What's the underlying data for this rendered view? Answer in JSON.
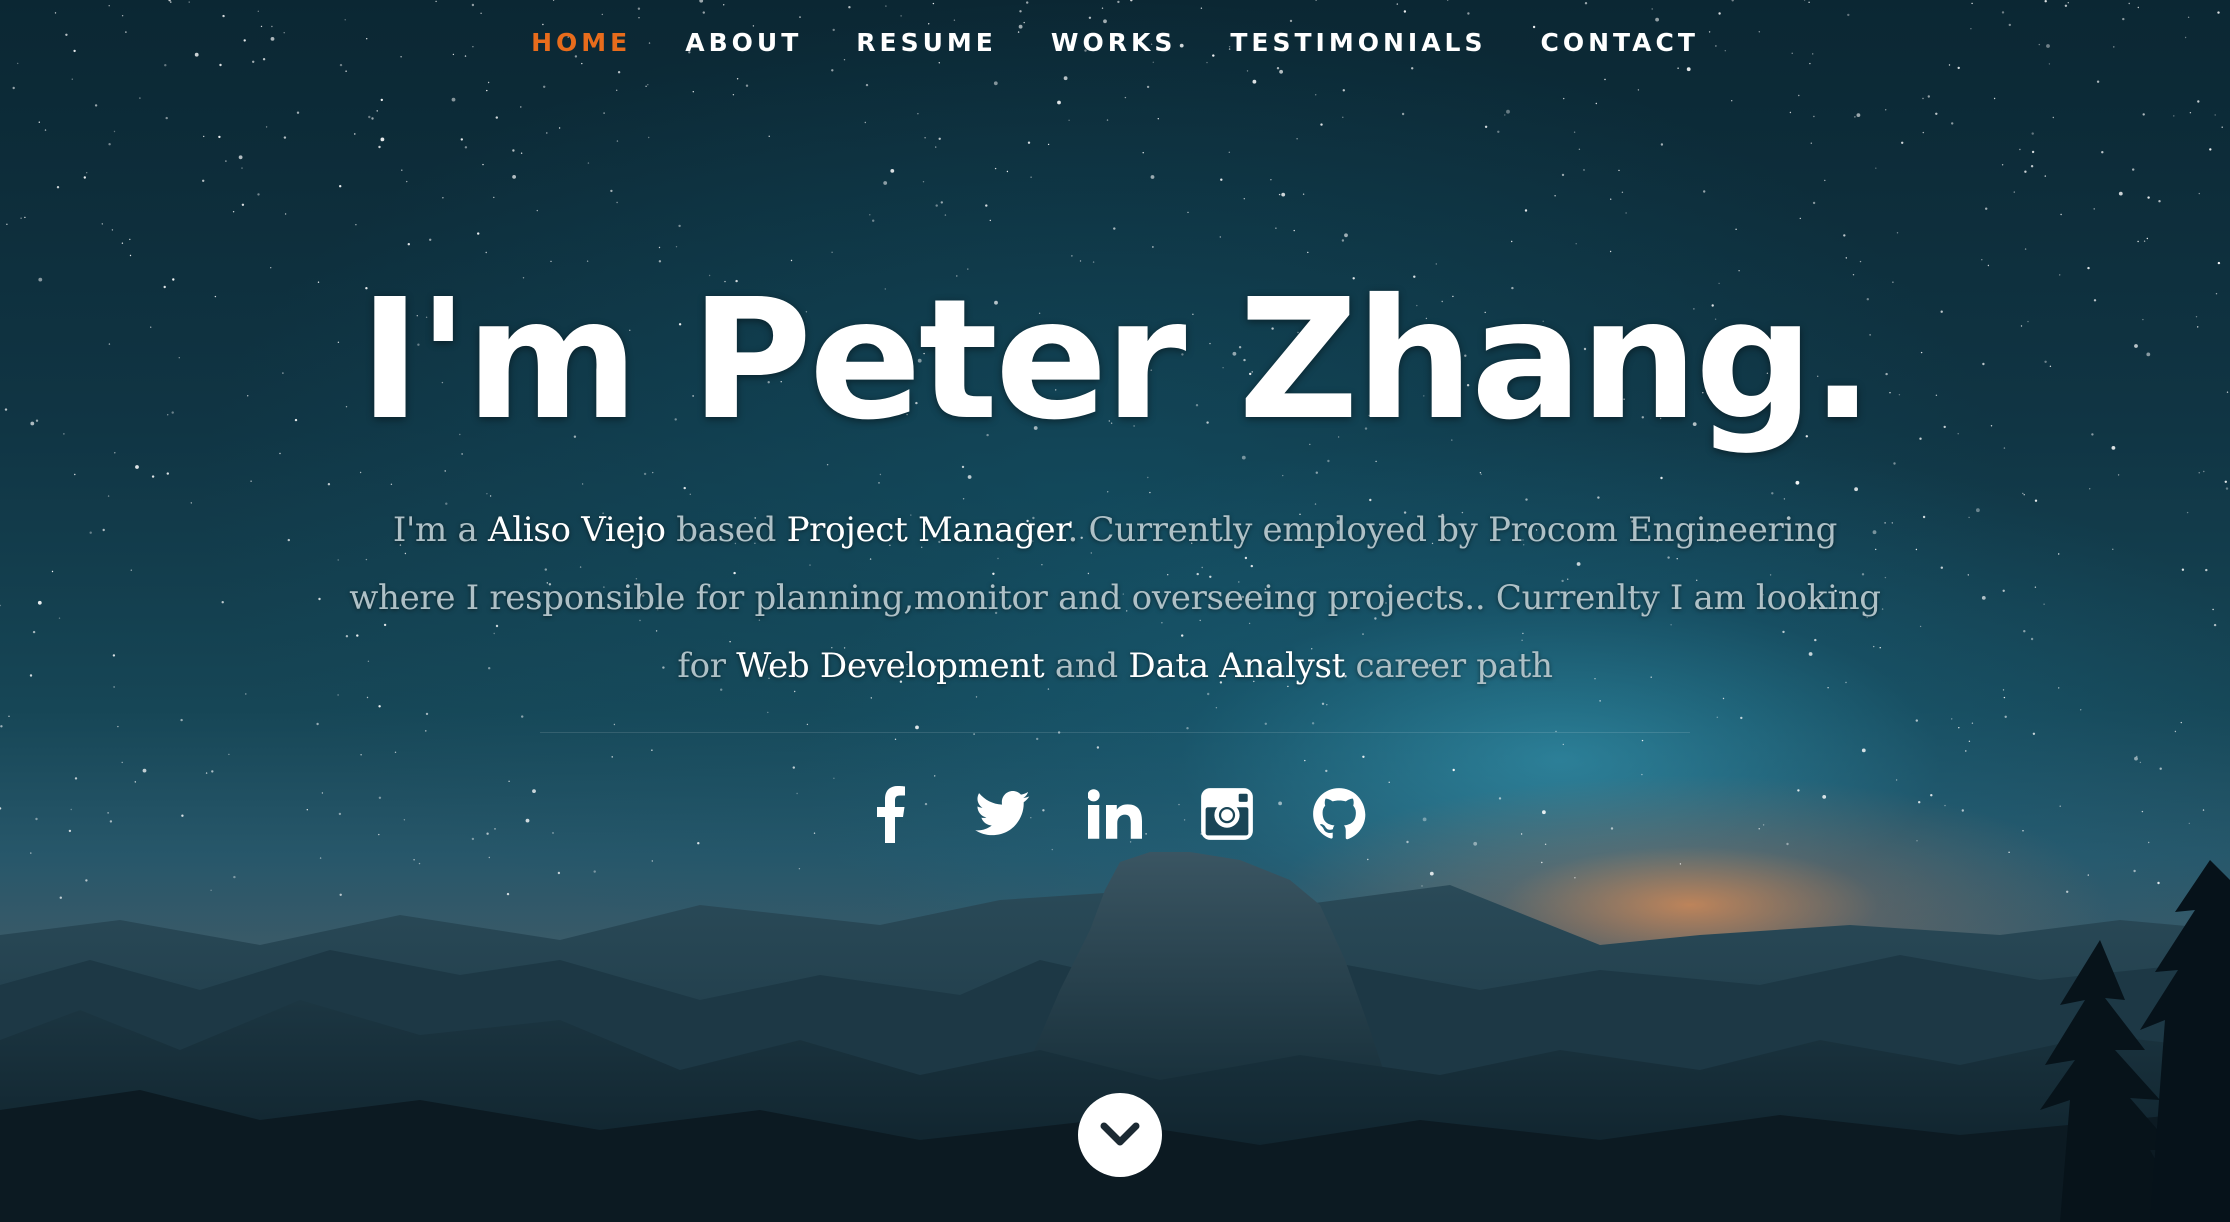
{
  "nav": {
    "items": [
      {
        "label": "HOME",
        "active": true
      },
      {
        "label": "ABOUT",
        "active": false
      },
      {
        "label": "RESUME",
        "active": false
      },
      {
        "label": "WORKS",
        "active": false
      },
      {
        "label": "TESTIMONIALS",
        "active": false
      },
      {
        "label": "CONTACT",
        "active": false
      }
    ],
    "active_color": "#e86c1c"
  },
  "hero": {
    "headline": "I'm Peter Zhang.",
    "intro": {
      "p1": "I'm a ",
      "location": "Aliso Viejo",
      "p2": " based ",
      "role": "Project Manager",
      "p3": ". Currently employed by Procom Engineering where I responsible for planning,monitor and overseeing projects.. Currenlty I am looking for ",
      "path1": "Web Development",
      "p4": " and ",
      "path2": "Data Analyst",
      "p5": " career path"
    }
  },
  "social": {
    "icons": [
      "facebook-icon",
      "twitter-icon",
      "linkedin-icon",
      "instagram-icon",
      "github-icon"
    ]
  },
  "scroll": {
    "icon": "chevron-down-icon"
  }
}
